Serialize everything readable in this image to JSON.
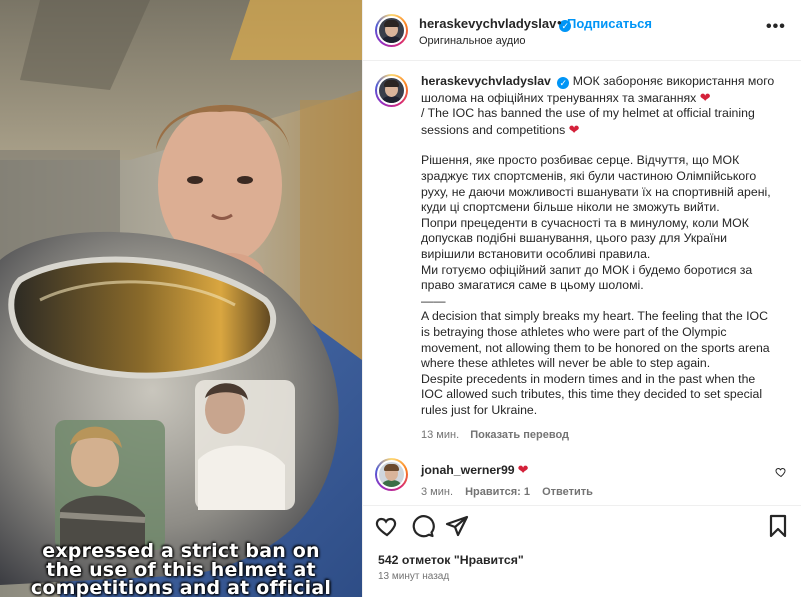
{
  "video": {
    "subtitle_lines": [
      "expressed a strict ban on",
      "the use of this helmet at",
      "competitions and at official"
    ]
  },
  "header": {
    "username": "heraskevychvladyslav",
    "verified_mark": "✓",
    "separator": "•",
    "follow_label": "Подписаться",
    "audio_label": "Оригинальное аудио",
    "more_label": "•••"
  },
  "caption": {
    "username": "heraskevychvladyslav",
    "verified_mark": "✓",
    "heart": "❤",
    "line_ua_1": "МОК забороняє використання мого шолома на офіційних тренуваннях та змаганнях",
    "line_en_1": "/ The IOC has banned the use of my helmet at official training sessions and competitions",
    "para_ua_1": "Рішення, яке просто розбиває серце. Відчуття, що МОК зраджує тих спортсменів, які були частиною Олімпійського руху, не даючи можливості вшанувати їх на спортивній арені, куди ці спортсмени більше ніколи не зможуть вийти.",
    "para_ua_2": "Попри прецеденти в сучасності та в минулому, коли МОК допускав подібні вшанування, цього разу для України вирішили встановити особливі правила.",
    "para_ua_3": "Ми готуємо офіційний запит до МОК і будемо боротися за право змагатися саме в цьому шоломі.",
    "separator_line": "——",
    "para_en_1": "A decision that simply breaks my heart. The feeling that the IOC is betraying those athletes who were part of the Olympic movement, not allowing them to be honored on the sports arena where these athletes will never be able to step again.",
    "para_en_2": "Despite precedents in modern times and in the past when the IOC allowed such tributes, this time they decided to set special rules just for Ukraine.",
    "time": "13 мин.",
    "translate_label": "Показать перевод"
  },
  "comment": {
    "username": "jonah_werner99",
    "heart": "❤",
    "time": "3 мин.",
    "likes": "Нравится: 1",
    "reply_label": "Ответить"
  },
  "actions": {
    "like_icon": "heart-icon",
    "comment_icon": "comment-icon",
    "share_icon": "share-icon",
    "save_icon": "bookmark-icon"
  },
  "footer": {
    "likes_text": "542 отметок \"Нравится\"",
    "time_ago": "13 минут назад"
  },
  "colors": {
    "accent": "#0095f6",
    "heart": "#d4213a",
    "muted": "#737373",
    "jacket": "#3b5f9c"
  }
}
